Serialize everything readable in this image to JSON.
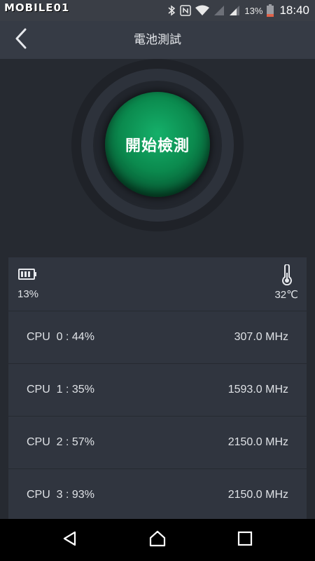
{
  "status_bar": {
    "watermark": "MOBILE01",
    "battery_percent": "13%",
    "time": "18:40",
    "icons": [
      "bluetooth-icon",
      "nfc-icon",
      "wifi-icon",
      "signal-icon",
      "signal-icon",
      "battery-icon"
    ],
    "battery_color": "#e0634a"
  },
  "header": {
    "title": "電池測試",
    "back_icon": "chevron-left-icon"
  },
  "gauge": {
    "start_label": "開始檢測",
    "accent_color": "#0b8a4e"
  },
  "summary": {
    "battery_icon": "battery-icon",
    "battery_value": "13%",
    "thermometer_icon": "thermometer-icon",
    "temperature_value": "32℃"
  },
  "cpus": [
    {
      "label": "CPU  0 : 44%",
      "frequency": "307.0 MHz"
    },
    {
      "label": "CPU  1 : 35%",
      "frequency": "1593.0 MHz"
    },
    {
      "label": "CPU  2 : 57%",
      "frequency": "2150.0 MHz"
    },
    {
      "label": "CPU  3 : 93%",
      "frequency": "2150.0 MHz"
    }
  ],
  "nav_bar": {
    "back_icon": "triangle-back-icon",
    "home_icon": "home-icon",
    "recents_icon": "square-recents-icon"
  }
}
